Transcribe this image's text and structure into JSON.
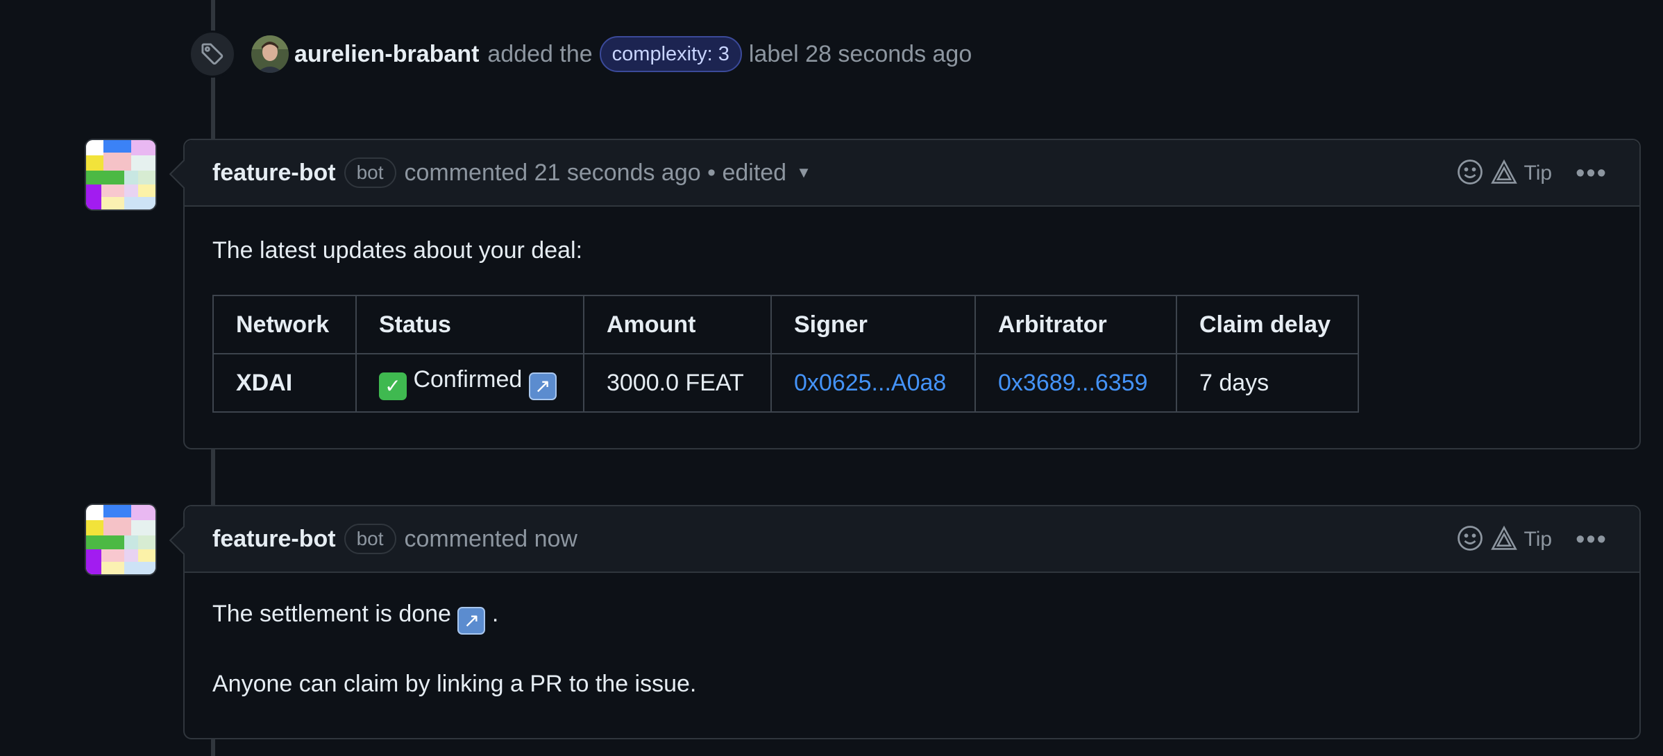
{
  "label_event": {
    "author": "aurelien-brabant",
    "verb": "added the",
    "label": "complexity: 3",
    "tail": "label 28 seconds ago",
    "icon": "tag-icon"
  },
  "comments": [
    {
      "author": "feature-bot",
      "badge": "bot",
      "meta": "commented 21 seconds ago • edited",
      "tip_label": "Tip",
      "intro": "The latest updates about your deal:",
      "table": {
        "headers": [
          "Network",
          "Status",
          "Amount",
          "Signer",
          "Arbitrator",
          "Claim delay"
        ],
        "row": {
          "network": "XDAI",
          "status_icon": "✓",
          "status": "Confirmed",
          "status_link_icon": "↗",
          "amount": "3000.0 FEAT",
          "signer": "0x0625...A0a8",
          "arbitrator": "0x3689...6359",
          "claim_delay": "7 days"
        }
      }
    },
    {
      "author": "feature-bot",
      "badge": "bot",
      "meta": "commented now",
      "tip_label": "Tip",
      "line1_prefix": "The settlement is done",
      "line1_icon": "↗",
      "line1_suffix": ".",
      "line2": "Anyone can claim by linking a PR to the issue."
    }
  ],
  "colors": {
    "background": "#0d1117",
    "link": "#4493f8",
    "label_bg": "#1c2451",
    "label_border": "#3b4a9a"
  }
}
